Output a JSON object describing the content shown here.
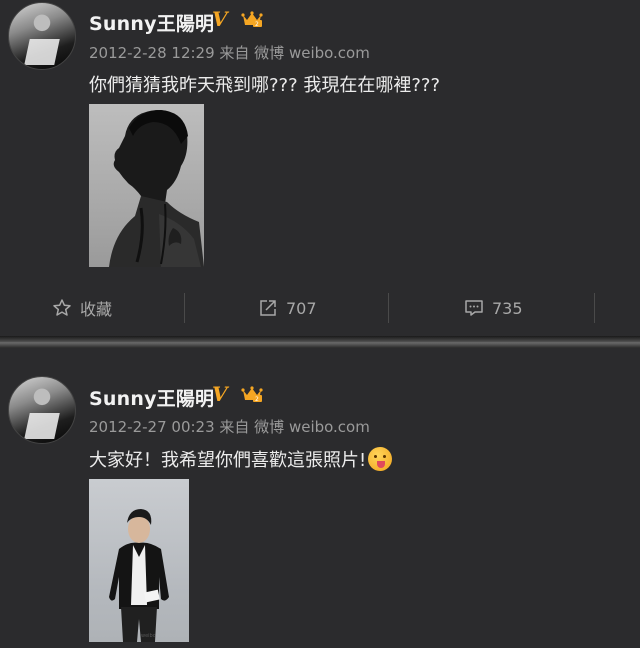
{
  "posts": [
    {
      "user_name": "Sunny王陽明",
      "verified_mark": "V",
      "timestamp": "2012-2-28 12:29",
      "source": "来自 微博 weibo.com",
      "text": "你們猜猜我昨天飛到哪??? 我現在在哪裡???",
      "actions": {
        "favorite_label": "收藏",
        "repost_count": "707",
        "comment_count": "735"
      }
    },
    {
      "user_name": "Sunny王陽明",
      "verified_mark": "V",
      "timestamp": "2012-2-27 00:23",
      "source": "来自 微博 weibo.com",
      "text": "大家好！我希望你們喜歡這張照片!",
      "emoji": "tongue-out-face"
    }
  ],
  "colors": {
    "background": "#2b2b2d",
    "verified": "#f5a623",
    "crown": "#f5a623",
    "meta_text": "#9a9a9a"
  }
}
